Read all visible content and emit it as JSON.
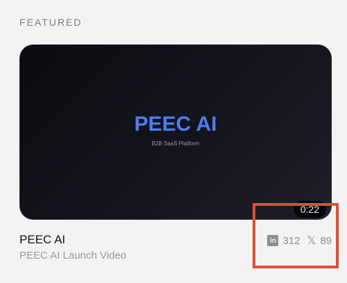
{
  "section": {
    "label": "FEATURED"
  },
  "card": {
    "brand": "PEEC AI",
    "subtitle": "B2B SaaS Platform",
    "duration": "0:22"
  },
  "video": {
    "title": "PEEC AI",
    "description": "PEEC AI Launch Video"
  },
  "stats": {
    "linkedin_count": "312",
    "x_count": "89",
    "linkedin_icon": "linkedin-icon",
    "x_icon": "x-icon"
  },
  "colors": {
    "accent": "#4c7ef3",
    "highlight": "#ea4a35"
  }
}
